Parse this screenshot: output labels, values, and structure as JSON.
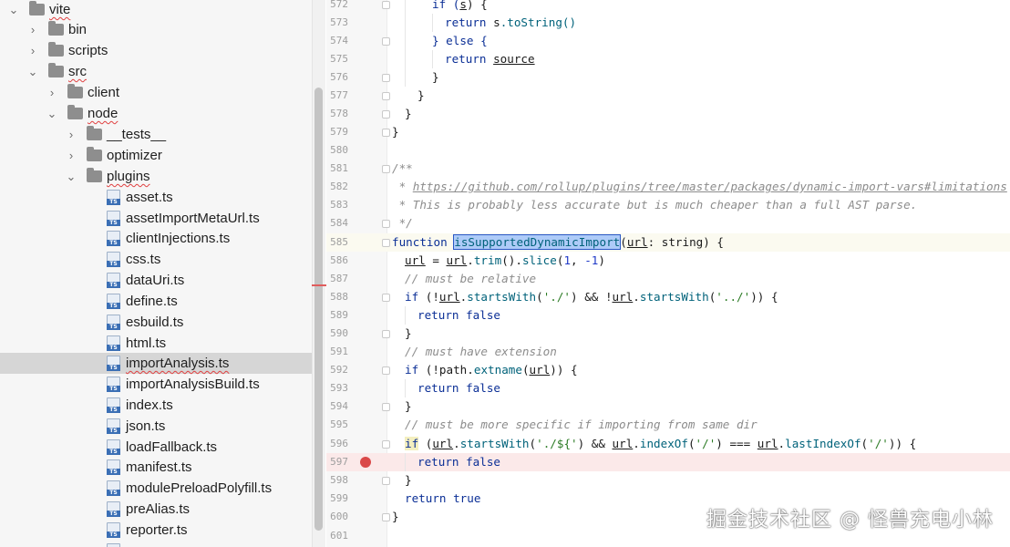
{
  "project_tree": {
    "folders": {
      "vite": "vite",
      "bin": "bin",
      "scripts": "scripts",
      "src": "src",
      "client": "client",
      "node": "node",
      "tests": "__tests__",
      "optimizer": "optimizer",
      "plugins": "plugins"
    },
    "file_badge": "TS",
    "files": [
      "asset.ts",
      "assetImportMetaUrl.ts",
      "clientInjections.ts",
      "css.ts",
      "dataUri.ts",
      "define.ts",
      "esbuild.ts",
      "html.ts",
      "importAnalysis.ts",
      "importAnalysisBuild.ts",
      "index.ts",
      "json.ts",
      "loadFallback.ts",
      "manifest.ts",
      "modulePreloadPolyfill.ts",
      "preAlias.ts",
      "reporter.ts"
    ],
    "selected_file": "importAnalysis.ts"
  },
  "editor": {
    "line_numbers": [
      "572",
      "573",
      "574",
      "575",
      "576",
      "577",
      "578",
      "579",
      "580",
      "581",
      "582",
      "583",
      "584",
      "585",
      "586",
      "587",
      "588",
      "589",
      "590",
      "591",
      "592",
      "593",
      "594",
      "595",
      "596",
      "597",
      "598",
      "599",
      "600",
      "601"
    ],
    "code": {
      "l572_a": "if (",
      "l572_b": "s",
      "l572_c": ") {",
      "l573_ret": "return",
      "l573_s": "s",
      "l573_rest": ".toString()",
      "l574": "} else {",
      "l575_ret": "return",
      "l575_src": "source",
      "l577": "}",
      "l578": "}",
      "l579": "}",
      "l581": "/**",
      "l582_star": " * ",
      "l582_link": "https://github.com/rollup/plugins/tree/master/packages/dynamic-import-vars#limitations",
      "l583": " * This is probably less accurate but is much cheaper than a full AST parse.",
      "l584": " */",
      "l585_kw": "function",
      "l585_name": "isSupportedDynamicImport",
      "l585_p1": "(",
      "l585_param": "url",
      "l585_p2": ": string) {",
      "l586_url1": "url",
      "l586_eq": " = ",
      "l586_url2": "url",
      "l586_dot1": ".",
      "l586_trim": "trim",
      "l586_mid": "().",
      "l586_slice": "slice",
      "l586_open": "(",
      "l586_one": "1",
      "l586_comma": ", ",
      "l586_neg": "-1",
      "l586_close": ")",
      "l587": "// must be relative",
      "l588_if": "if",
      "l588_a": " (!",
      "l588_url1": "url",
      "l588_b": ".",
      "l588_sw1": "startsWith",
      "l588_c": "(",
      "l588_s1": "'./'",
      "l588_d": ") && !",
      "l588_url2": "url",
      "l588_e": ".",
      "l588_sw2": "startsWith",
      "l588_f": "(",
      "l588_s2": "'../'",
      "l588_g": ")) {",
      "l589_ret": "return",
      "l589_false": "false",
      "l590": "}",
      "l591": "// must have extension",
      "l592_if": "if",
      "l592_a": " (!",
      "l592_path": "path",
      "l592_b": ".",
      "l592_ext": "extname",
      "l592_c": "(",
      "l592_url": "url",
      "l592_d": ")) {",
      "l593_ret": "return",
      "l593_false": "false",
      "l594": "}",
      "l595": "// must be more specific if importing from same dir",
      "l596_if": "if",
      "l596_a": " (",
      "l596_url1": "url",
      "l596_b": ".",
      "l596_sw": "startsWith",
      "l596_c": "(",
      "l596_s1": "'./${'",
      "l596_d": ") && ",
      "l596_url2": "url",
      "l596_e": ".",
      "l596_io": "indexOf",
      "l596_f": "(",
      "l596_s2": "'/'",
      "l596_g": ") === ",
      "l596_url3": "url",
      "l596_h": ".",
      "l596_lio": "lastIndexOf",
      "l596_i": "(",
      "l596_s3": "'/'",
      "l596_j": ")) {",
      "l597_ret": "return",
      "l597_false": "false",
      "l598": "}",
      "l599_ret": "return",
      "l599_true": "true",
      "l600": "}"
    },
    "highlighted_line": "585",
    "breakpoint_line": "597"
  },
  "watermark": "掘金技术社区 @ 怪兽充电小林",
  "colors": {
    "keyword": "#0b2f96",
    "string": "#2d7c26",
    "comment": "#8c8c8c",
    "breakpoint": "#da4848",
    "selection_row": "#d6d6d6"
  }
}
